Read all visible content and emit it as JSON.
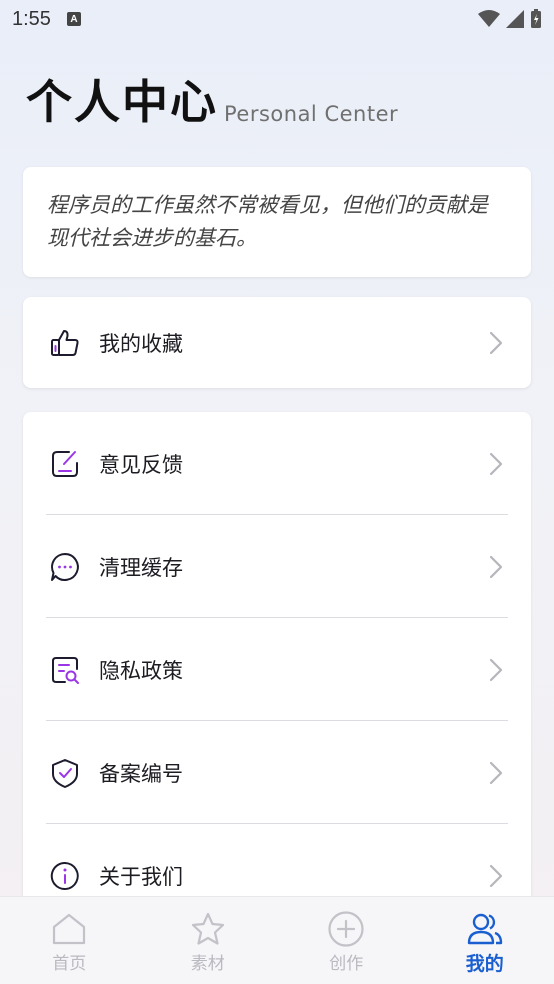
{
  "status_bar": {
    "time": "1:55",
    "notification_letter": "A"
  },
  "header": {
    "title": "个人中心",
    "subtitle": "Personal Center"
  },
  "quote": {
    "text": "程序员的工作虽然不常被看见，但他们的贡献是现代社会进步的基石。"
  },
  "favorites": {
    "label": "我的收藏",
    "icon": "thumbs-up-icon"
  },
  "menu": [
    {
      "label": "意见反馈",
      "icon": "edit-square-icon"
    },
    {
      "label": "清理缓存",
      "icon": "chat-dots-icon"
    },
    {
      "label": "隐私政策",
      "icon": "document-search-icon"
    },
    {
      "label": "备案编号",
      "icon": "shield-check-icon"
    },
    {
      "label": "关于我们",
      "icon": "info-circle-icon"
    }
  ],
  "tabs": [
    {
      "label": "首页",
      "icon": "home-icon",
      "active": false
    },
    {
      "label": "素材",
      "icon": "star-icon",
      "active": false
    },
    {
      "label": "创作",
      "icon": "plus-circle-icon",
      "active": false
    },
    {
      "label": "我的",
      "icon": "user-group-icon",
      "active": true
    }
  ],
  "colors": {
    "accent_purple": "#9b36e6",
    "tab_active": "#1a5fd0",
    "tab_inactive": "#b9b9c0"
  }
}
